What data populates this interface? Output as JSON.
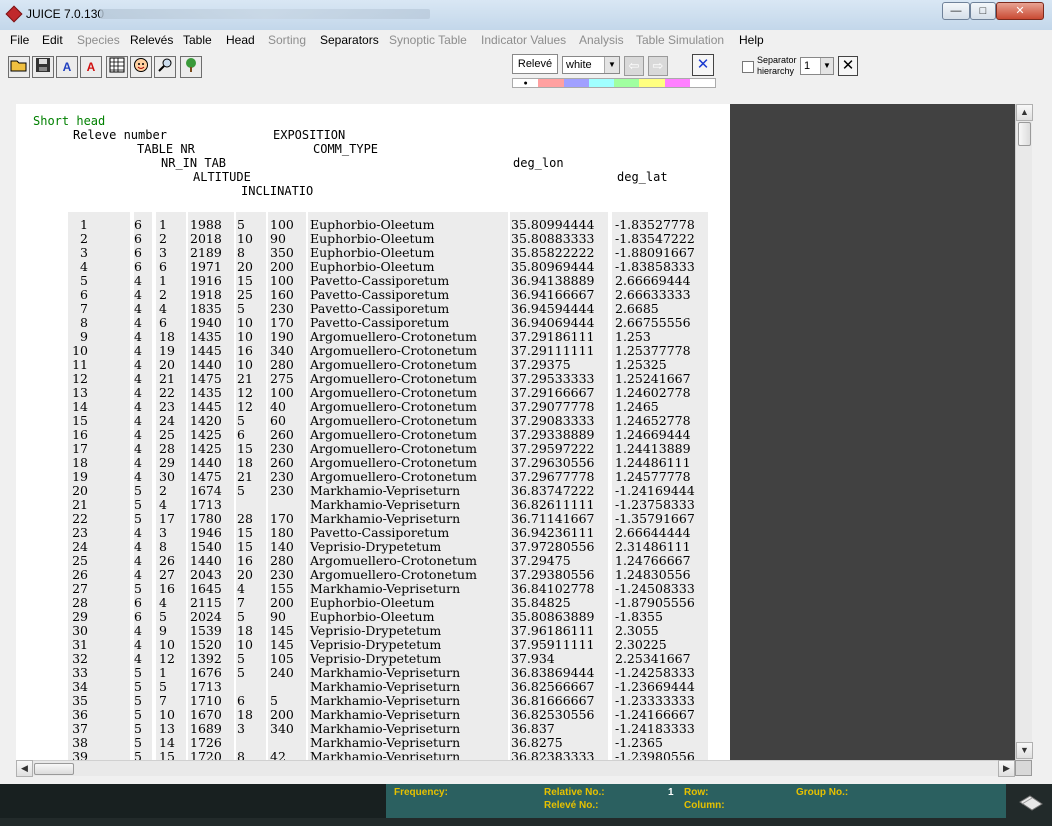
{
  "window": {
    "title": "JUICE 7.0.130",
    "min": "—",
    "max": "□",
    "close": "✕"
  },
  "menu": [
    "File",
    "Edit",
    "Species",
    "Relevés",
    "Table",
    "Head",
    "Sorting",
    "Separators",
    "Synoptic Table",
    "Indicator Values",
    "Analysis",
    "Table Simulation",
    "Help"
  ],
  "menu_disabled": [
    "Species",
    "Sorting",
    "Synoptic Table",
    "Indicator Values",
    "Analysis",
    "Table Simulation"
  ],
  "toolbar": {
    "buttons": [
      "open-folder-icon",
      "save-icon",
      "species-a-icon",
      "red-a-icon",
      "table-icon",
      "face-icon",
      "search-icon",
      "tree-icon"
    ],
    "relevebox": "Relevé",
    "color_select": "white",
    "nav_prev": "⇦",
    "nav_next": "⇨",
    "x_label": "✕",
    "separator_label_1": "Separator",
    "separator_label_2": "hierarchy",
    "hierarchy_value": "1",
    "palette": [
      "#ffffff",
      "#ffa0a0",
      "#a0a0ff",
      "#a0ffff",
      "#a0ffa0",
      "#ffff80",
      "#ff80ff",
      "#ffffff"
    ],
    "palette_marker": "●"
  },
  "header_lines": {
    "short_head": "Short head",
    "releve_number": "Releve number",
    "exposition": "EXPOSITION",
    "table_nr": "TABLE NR",
    "comm_type": "COMM_TYPE",
    "nr_in_tab": "NR_IN TAB",
    "deg_lon": "deg_lon",
    "altitude": "ALTITUDE",
    "deg_lat": "deg_lat",
    "inclinatio": "INCLINATIO"
  },
  "rows": [
    [
      "1",
      "6",
      "1",
      "1988",
      "5",
      "100",
      "Euphorbio-Oleetum",
      "35.80994444",
      "-1.83527778"
    ],
    [
      "2",
      "6",
      "2",
      "2018",
      "10",
      "90",
      "Euphorbio-Oleetum",
      "35.80883333",
      "-1.83547222"
    ],
    [
      "3",
      "6",
      "3",
      "2189",
      "8",
      "350",
      "Euphorbio-Oleetum",
      "35.85822222",
      "-1.88091667"
    ],
    [
      "4",
      "6",
      "6",
      "1971",
      "20",
      "200",
      "Euphorbio-Oleetum",
      "35.80969444",
      "-1.83858333"
    ],
    [
      "5",
      "4",
      "1",
      "1916",
      "15",
      "100",
      "Pavetto-Cassiporetum",
      "36.94138889",
      "2.66669444"
    ],
    [
      "6",
      "4",
      "2",
      "1918",
      "25",
      "160",
      "Pavetto-Cassiporetum",
      "36.94166667",
      "2.66633333"
    ],
    [
      "7",
      "4",
      "4",
      "1835",
      "5",
      "230",
      "Pavetto-Cassiporetum",
      "36.94594444",
      "2.6685"
    ],
    [
      "8",
      "4",
      "6",
      "1940",
      "10",
      "170",
      "Pavetto-Cassiporetum",
      "36.94069444",
      "2.66755556"
    ],
    [
      "9",
      "4",
      "18",
      "1435",
      "10",
      "190",
      "Argomuellero-Crotonetum",
      "37.29186111",
      "1.253"
    ],
    [
      "10",
      "4",
      "19",
      "1445",
      "16",
      "340",
      "Argomuellero-Crotonetum",
      "37.29111111",
      "1.25377778"
    ],
    [
      "11",
      "4",
      "20",
      "1440",
      "10",
      "280",
      "Argomuellero-Crotonetum",
      "37.29375",
      "1.25325"
    ],
    [
      "12",
      "4",
      "21",
      "1475",
      "21",
      "275",
      "Argomuellero-Crotonetum",
      "37.29533333",
      "1.25241667"
    ],
    [
      "13",
      "4",
      "22",
      "1435",
      "12",
      "100",
      "Argomuellero-Crotonetum",
      "37.29166667",
      "1.24602778"
    ],
    [
      "14",
      "4",
      "23",
      "1445",
      "12",
      "40",
      "Argomuellero-Crotonetum",
      "37.29077778",
      "1.2465"
    ],
    [
      "15",
      "4",
      "24",
      "1420",
      "5",
      "60",
      "Argomuellero-Crotonetum",
      "37.29083333",
      "1.24652778"
    ],
    [
      "16",
      "4",
      "25",
      "1425",
      "6",
      "260",
      "Argomuellero-Crotonetum",
      "37.29338889",
      "1.24669444"
    ],
    [
      "17",
      "4",
      "28",
      "1425",
      "15",
      "230",
      "Argomuellero-Crotonetum",
      "37.29597222",
      "1.24413889"
    ],
    [
      "18",
      "4",
      "29",
      "1440",
      "18",
      "260",
      "Argomuellero-Crotonetum",
      "37.29630556",
      "1.24486111"
    ],
    [
      "19",
      "4",
      "30",
      "1475",
      "21",
      "230",
      "Argomuellero-Crotonetum",
      "37.29677778",
      "1.24577778"
    ],
    [
      "20",
      "5",
      "2",
      "1674",
      "5",
      "230",
      "Markhamio-Vepriseturn",
      "36.83747222",
      "-1.24169444"
    ],
    [
      "21",
      "5",
      "4",
      "1713",
      "",
      "",
      "Markhamio-Vepriseturn",
      "36.82611111",
      "-1.23758333"
    ],
    [
      "22",
      "5",
      "17",
      "1780",
      "28",
      "170",
      "Markhamio-Vepriseturn",
      "36.71141667",
      "-1.35791667"
    ],
    [
      "23",
      "4",
      "3",
      "1946",
      "15",
      "180",
      "Pavetto-Cassiporetum",
      "36.94236111",
      "2.66644444"
    ],
    [
      "24",
      "4",
      "8",
      "1540",
      "15",
      "140",
      "Veprisio-Drypetetum",
      "37.97280556",
      "2.31486111"
    ],
    [
      "25",
      "4",
      "26",
      "1440",
      "16",
      "280",
      "Argomuellero-Crotonetum",
      "37.29475",
      "1.24766667"
    ],
    [
      "26",
      "4",
      "27",
      "2043",
      "20",
      "230",
      "Argomuellero-Crotonetum",
      "37.29380556",
      "1.24830556"
    ],
    [
      "27",
      "5",
      "16",
      "1645",
      "4",
      "155",
      "Markhamio-Vepriseturn",
      "36.84102778",
      "-1.24508333"
    ],
    [
      "28",
      "6",
      "4",
      "2115",
      "7",
      "200",
      "Euphorbio-Oleetum",
      "35.84825",
      "-1.87905556"
    ],
    [
      "29",
      "6",
      "5",
      "2024",
      "5",
      "90",
      "Euphorbio-Oleetum",
      "35.80863889",
      "-1.8355"
    ],
    [
      "30",
      "4",
      "9",
      "1539",
      "18",
      "145",
      "Veprisio-Drypetetum",
      "37.96186111",
      "2.3055"
    ],
    [
      "31",
      "4",
      "10",
      "1520",
      "10",
      "145",
      "Veprisio-Drypetetum",
      "37.95911111",
      "2.30225"
    ],
    [
      "32",
      "4",
      "12",
      "1392",
      "5",
      "105",
      "Veprisio-Drypetetum",
      "37.934",
      "2.25341667"
    ],
    [
      "33",
      "5",
      "1",
      "1676",
      "5",
      "240",
      "Markhamio-Vepriseturn",
      "36.83869444",
      "-1.24258333"
    ],
    [
      "34",
      "5",
      "5",
      "1713",
      "",
      "",
      "Markhamio-Vepriseturn",
      "36.82566667",
      "-1.23669444"
    ],
    [
      "35",
      "5",
      "7",
      "1710",
      "6",
      "5",
      "Markhamio-Vepriseturn",
      "36.81666667",
      "-1.23333333"
    ],
    [
      "36",
      "5",
      "10",
      "1670",
      "18",
      "200",
      "Markhamio-Vepriseturn",
      "36.82530556",
      "-1.24166667"
    ],
    [
      "37",
      "5",
      "13",
      "1689",
      "3",
      "340",
      "Markhamio-Vepriseturn",
      "36.837",
      "-1.24183333"
    ],
    [
      "38",
      "5",
      "14",
      "1726",
      "",
      "",
      "Markhamio-Vepriseturn",
      "36.8275",
      "-1.2365"
    ],
    [
      "39",
      "5",
      "15",
      "1720",
      "8",
      "42",
      "Markhamio-Vepriseturn",
      "36.82383333",
      "-1.23980556"
    ]
  ],
  "status": {
    "frequency": "Frequency:",
    "relative_no": "Relative No.:",
    "relative_no_value": "1",
    "releve_no": "Relevé No.:",
    "row": "Row:",
    "column": "Column:",
    "group_no": "Group No.:"
  }
}
